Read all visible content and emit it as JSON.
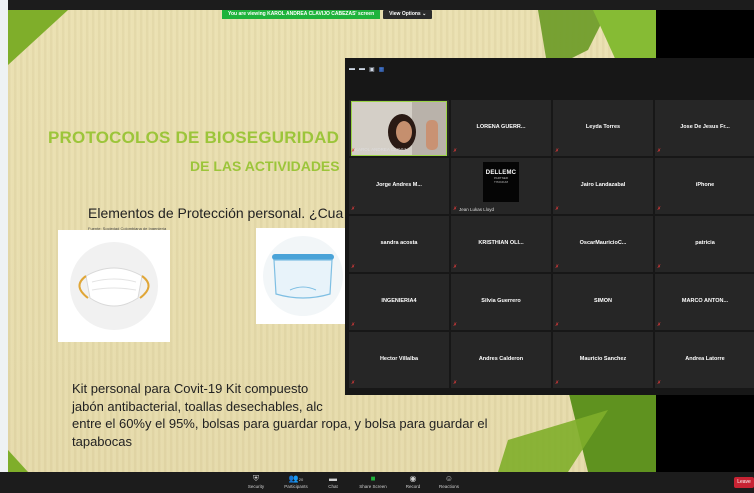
{
  "banner": {
    "viewing_text": "You are viewing KAROL ANDREA CLAVIJO CABEZAS' screen",
    "view_options": "View Options ⌄"
  },
  "slide": {
    "title_line1": "PROTOCOLOS DE BIOSEGURIDAD",
    "title_line2": "DE LAS ACTIVIDADES",
    "elementos": "Elementos de Protección personal.  ¿Cua",
    "fuente": "Fuente: Sociedad Colombiana de Ingeniería",
    "para_lines": [
      "Kit personal para Covit-19 Kit compuesto",
      "jabón antibacterial, toallas desechables, alc",
      "entre el 60%y el 95%,  bolsas para guardar ropa, y bolsa para guardar el",
      "tapabocas"
    ]
  },
  "participants": [
    {
      "name": "KAROL ANDREA CLAVIJ...",
      "type": "video"
    },
    {
      "name": "LORENA GUERR...",
      "type": "name"
    },
    {
      "name": "Leyda Torres",
      "type": "name"
    },
    {
      "name": "Jose De Jesus Fr...",
      "type": "name"
    },
    {
      "name": "Jorge Andres M...",
      "type": "name"
    },
    {
      "name": "Jean Lukas Lloyd",
      "type": "logo"
    },
    {
      "name": "Jairo Landazabal",
      "type": "name"
    },
    {
      "name": "iPhone",
      "type": "name"
    },
    {
      "name": "sandra acosta",
      "type": "name"
    },
    {
      "name": "KRISTHIAN OLI...",
      "type": "name"
    },
    {
      "name": "OscarMauricioC...",
      "type": "name"
    },
    {
      "name": "patricia",
      "type": "name"
    },
    {
      "name": "INGENIERIA4",
      "type": "name"
    },
    {
      "name": "Silvia Guerrero",
      "type": "name"
    },
    {
      "name": "SIMON",
      "type": "name"
    },
    {
      "name": "MARCO  ANTON...",
      "type": "name"
    },
    {
      "name": "Hector Villalba",
      "type": "name"
    },
    {
      "name": "Andres Calderon",
      "type": "name"
    },
    {
      "name": "Mauricio Sanchez",
      "type": "name"
    },
    {
      "name": "Andrea Latorre",
      "type": "name"
    }
  ],
  "dell_logo": {
    "brand": "DELLEMC",
    "line1": "PARTNER",
    "line2": "TITANIUM"
  },
  "toolbar": {
    "security": "Security",
    "participants": "Participants",
    "participants_count": "20",
    "chat": "Chat",
    "share": "Share Screen",
    "record": "Record",
    "reactions": "Reactions",
    "leave": "Leave"
  },
  "colors": {
    "slide_bg": "#e8ddae",
    "title_green": "#9cc53a",
    "zoom_green": "#1fb33c",
    "leave_red": "#c82333"
  }
}
